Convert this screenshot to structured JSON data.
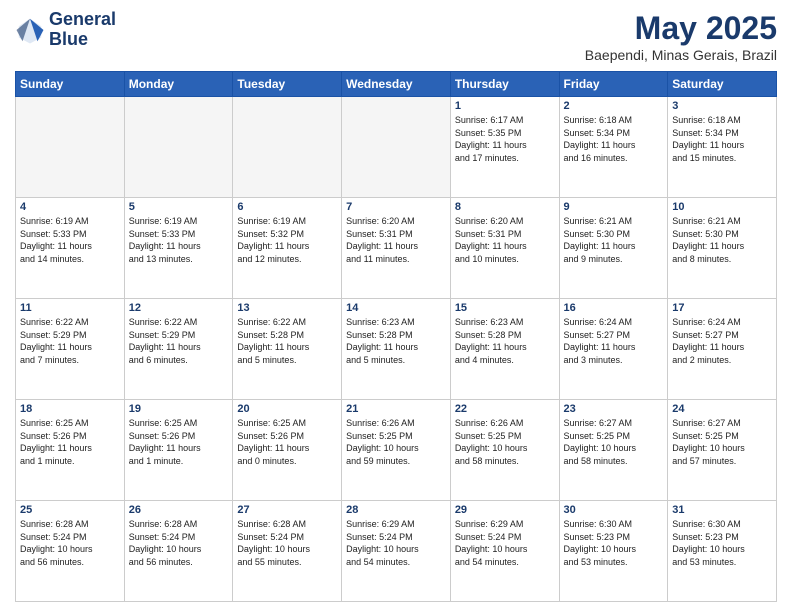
{
  "header": {
    "logo_line1": "General",
    "logo_line2": "Blue",
    "month_title": "May 2025",
    "location": "Baependi, Minas Gerais, Brazil"
  },
  "weekdays": [
    "Sunday",
    "Monday",
    "Tuesday",
    "Wednesday",
    "Thursday",
    "Friday",
    "Saturday"
  ],
  "weeks": [
    [
      {
        "day": "",
        "info": ""
      },
      {
        "day": "",
        "info": ""
      },
      {
        "day": "",
        "info": ""
      },
      {
        "day": "",
        "info": ""
      },
      {
        "day": "1",
        "info": "Sunrise: 6:17 AM\nSunset: 5:35 PM\nDaylight: 11 hours\nand 17 minutes."
      },
      {
        "day": "2",
        "info": "Sunrise: 6:18 AM\nSunset: 5:34 PM\nDaylight: 11 hours\nand 16 minutes."
      },
      {
        "day": "3",
        "info": "Sunrise: 6:18 AM\nSunset: 5:34 PM\nDaylight: 11 hours\nand 15 minutes."
      }
    ],
    [
      {
        "day": "4",
        "info": "Sunrise: 6:19 AM\nSunset: 5:33 PM\nDaylight: 11 hours\nand 14 minutes."
      },
      {
        "day": "5",
        "info": "Sunrise: 6:19 AM\nSunset: 5:33 PM\nDaylight: 11 hours\nand 13 minutes."
      },
      {
        "day": "6",
        "info": "Sunrise: 6:19 AM\nSunset: 5:32 PM\nDaylight: 11 hours\nand 12 minutes."
      },
      {
        "day": "7",
        "info": "Sunrise: 6:20 AM\nSunset: 5:31 PM\nDaylight: 11 hours\nand 11 minutes."
      },
      {
        "day": "8",
        "info": "Sunrise: 6:20 AM\nSunset: 5:31 PM\nDaylight: 11 hours\nand 10 minutes."
      },
      {
        "day": "9",
        "info": "Sunrise: 6:21 AM\nSunset: 5:30 PM\nDaylight: 11 hours\nand 9 minutes."
      },
      {
        "day": "10",
        "info": "Sunrise: 6:21 AM\nSunset: 5:30 PM\nDaylight: 11 hours\nand 8 minutes."
      }
    ],
    [
      {
        "day": "11",
        "info": "Sunrise: 6:22 AM\nSunset: 5:29 PM\nDaylight: 11 hours\nand 7 minutes."
      },
      {
        "day": "12",
        "info": "Sunrise: 6:22 AM\nSunset: 5:29 PM\nDaylight: 11 hours\nand 6 minutes."
      },
      {
        "day": "13",
        "info": "Sunrise: 6:22 AM\nSunset: 5:28 PM\nDaylight: 11 hours\nand 5 minutes."
      },
      {
        "day": "14",
        "info": "Sunrise: 6:23 AM\nSunset: 5:28 PM\nDaylight: 11 hours\nand 5 minutes."
      },
      {
        "day": "15",
        "info": "Sunrise: 6:23 AM\nSunset: 5:28 PM\nDaylight: 11 hours\nand 4 minutes."
      },
      {
        "day": "16",
        "info": "Sunrise: 6:24 AM\nSunset: 5:27 PM\nDaylight: 11 hours\nand 3 minutes."
      },
      {
        "day": "17",
        "info": "Sunrise: 6:24 AM\nSunset: 5:27 PM\nDaylight: 11 hours\nand 2 minutes."
      }
    ],
    [
      {
        "day": "18",
        "info": "Sunrise: 6:25 AM\nSunset: 5:26 PM\nDaylight: 11 hours\nand 1 minute."
      },
      {
        "day": "19",
        "info": "Sunrise: 6:25 AM\nSunset: 5:26 PM\nDaylight: 11 hours\nand 1 minute."
      },
      {
        "day": "20",
        "info": "Sunrise: 6:25 AM\nSunset: 5:26 PM\nDaylight: 11 hours\nand 0 minutes."
      },
      {
        "day": "21",
        "info": "Sunrise: 6:26 AM\nSunset: 5:25 PM\nDaylight: 10 hours\nand 59 minutes."
      },
      {
        "day": "22",
        "info": "Sunrise: 6:26 AM\nSunset: 5:25 PM\nDaylight: 10 hours\nand 58 minutes."
      },
      {
        "day": "23",
        "info": "Sunrise: 6:27 AM\nSunset: 5:25 PM\nDaylight: 10 hours\nand 58 minutes."
      },
      {
        "day": "24",
        "info": "Sunrise: 6:27 AM\nSunset: 5:25 PM\nDaylight: 10 hours\nand 57 minutes."
      }
    ],
    [
      {
        "day": "25",
        "info": "Sunrise: 6:28 AM\nSunset: 5:24 PM\nDaylight: 10 hours\nand 56 minutes."
      },
      {
        "day": "26",
        "info": "Sunrise: 6:28 AM\nSunset: 5:24 PM\nDaylight: 10 hours\nand 56 minutes."
      },
      {
        "day": "27",
        "info": "Sunrise: 6:28 AM\nSunset: 5:24 PM\nDaylight: 10 hours\nand 55 minutes."
      },
      {
        "day": "28",
        "info": "Sunrise: 6:29 AM\nSunset: 5:24 PM\nDaylight: 10 hours\nand 54 minutes."
      },
      {
        "day": "29",
        "info": "Sunrise: 6:29 AM\nSunset: 5:24 PM\nDaylight: 10 hours\nand 54 minutes."
      },
      {
        "day": "30",
        "info": "Sunrise: 6:30 AM\nSunset: 5:23 PM\nDaylight: 10 hours\nand 53 minutes."
      },
      {
        "day": "31",
        "info": "Sunrise: 6:30 AM\nSunset: 5:23 PM\nDaylight: 10 hours\nand 53 minutes."
      }
    ]
  ]
}
